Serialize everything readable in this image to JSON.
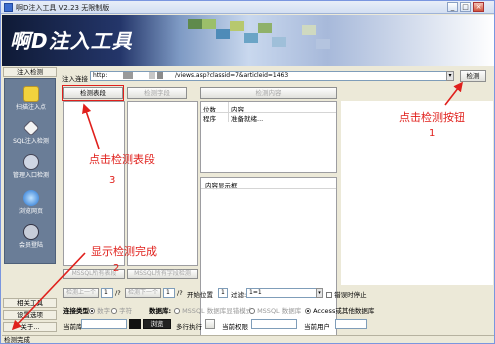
{
  "window": {
    "title": "啊D注入工具 V2.23 无限制版",
    "min": "_",
    "max": "□",
    "close": "×"
  },
  "banner": {
    "logo": "啊D注入工具"
  },
  "sidebar": {
    "top_tab": "注入检测",
    "items": [
      {
        "label": "扫描注入点",
        "icon": "arrow-folder-icon"
      },
      {
        "label": "SQL注入检测",
        "icon": "diamond-icon"
      },
      {
        "label": "管理入口检测",
        "icon": "people-icon"
      },
      {
        "label": "浏览网页",
        "icon": "globe-icon"
      },
      {
        "label": "会员登陆",
        "icon": "people-key-icon"
      }
    ],
    "bottom_tabs": [
      "相关工具",
      "设置选项",
      "关于..."
    ]
  },
  "toolbar": {
    "inject_label": "注入连接",
    "url_prefix": "http:",
    "url_suffix": "/views.asp?classid=7&articleid=1463",
    "detect_btn": "检测",
    "detect_table_btn": "检测表段",
    "detect_field_btn": "检测字段",
    "detect_content_btn": "检测内容"
  },
  "result_table": {
    "col1": "位数",
    "col2": "内容",
    "row_key": "程序",
    "row_val": "准备就绪..."
  },
  "content_box": {
    "title": "内容显示框"
  },
  "left_bottom_btns": {
    "all_tables": "MSSQL所有表段",
    "all_fields": "MSSQL所有字段检测"
  },
  "pager": {
    "prev": "检测上一个",
    "page1": "1",
    "sep1": "/?",
    "next": "检测下一个",
    "page2": "1",
    "sep2": "/?",
    "start_label": "开始位置",
    "start_val": "1",
    "filter_label": "过滤:",
    "filter_val": "1=1",
    "stop_on_error": "错误时停止"
  },
  "options": {
    "conn_type_label": "连接类型",
    "conn_num": "数字",
    "conn_char": "字符",
    "db_label": "数据库:",
    "db_mssql1": "MSSQL 数据库显错模式",
    "db_mssql2": "MSSQL 数据库",
    "db_access": "Access或其他数据库"
  },
  "info_row": {
    "cur_db_label": "当前库",
    "cur_db_val": "",
    "btn_black": "",
    "btn_ping": "浏览",
    "multi_exec": "多行执行",
    "cur_perm_label": "当前权限",
    "cur_user_label": "当前用户"
  },
  "status": {
    "text": "检测完成"
  },
  "annotations": {
    "click_detect_btn": "点击检测按钮",
    "num1": "1",
    "click_detect_table": "点击检测表段",
    "num3": "3",
    "show_done": "显示检测完成",
    "num2": "2"
  },
  "colors": {
    "annotation_red": "#e0201c",
    "sidebar_bg": "#6a7d97"
  }
}
